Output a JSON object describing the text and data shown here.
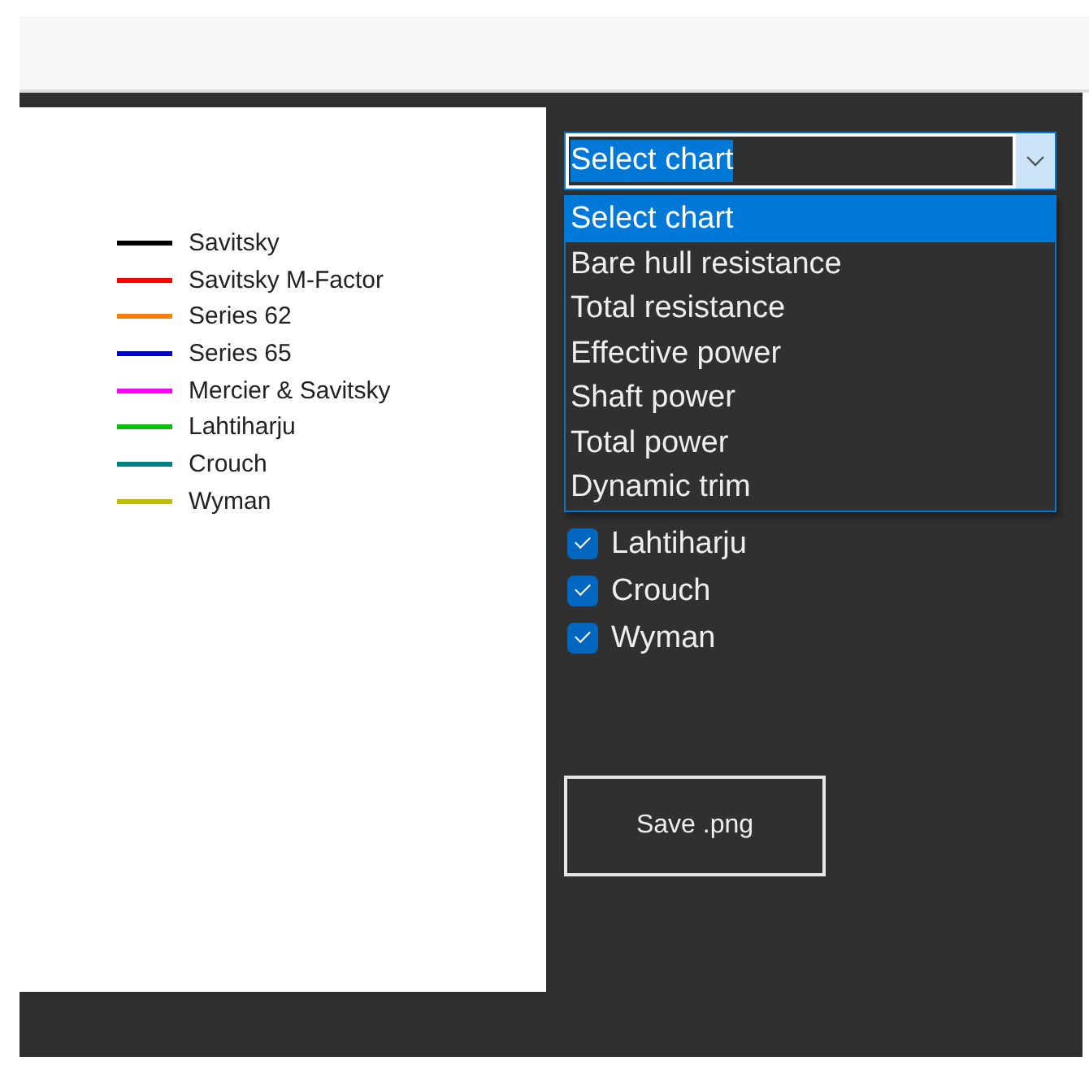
{
  "legend": [
    {
      "label": "Savitsky",
      "color": "#000000"
    },
    {
      "label": "Savitsky M-Factor",
      "color": "#ff0000"
    },
    {
      "label": "Series 62",
      "color": "#ff8000"
    },
    {
      "label": "Series 65",
      "color": "#0000c0"
    },
    {
      "label": "Mercier & Savitsky",
      "color": "#ff00ff"
    },
    {
      "label": "Lahtiharju",
      "color": "#00c000"
    },
    {
      "label": "Crouch",
      "color": "#008080"
    },
    {
      "label": "Wyman",
      "color": "#c0c000"
    }
  ],
  "chart_selector": {
    "value": "Select chart",
    "expanded": true,
    "options": [
      {
        "label": "Select chart",
        "selected": true
      },
      {
        "label": "Bare hull resistance",
        "selected": false
      },
      {
        "label": "Total resistance",
        "selected": false
      },
      {
        "label": "Effective power",
        "selected": false
      },
      {
        "label": "Shaft power",
        "selected": false
      },
      {
        "label": "Total power",
        "selected": false
      },
      {
        "label": "Dynamic trim",
        "selected": false
      }
    ]
  },
  "series_checkboxes": [
    {
      "label": "Lahtiharju",
      "checked": true
    },
    {
      "label": "Crouch",
      "checked": true
    },
    {
      "label": "Wyman",
      "checked": true
    }
  ],
  "save_button": "Save .png"
}
